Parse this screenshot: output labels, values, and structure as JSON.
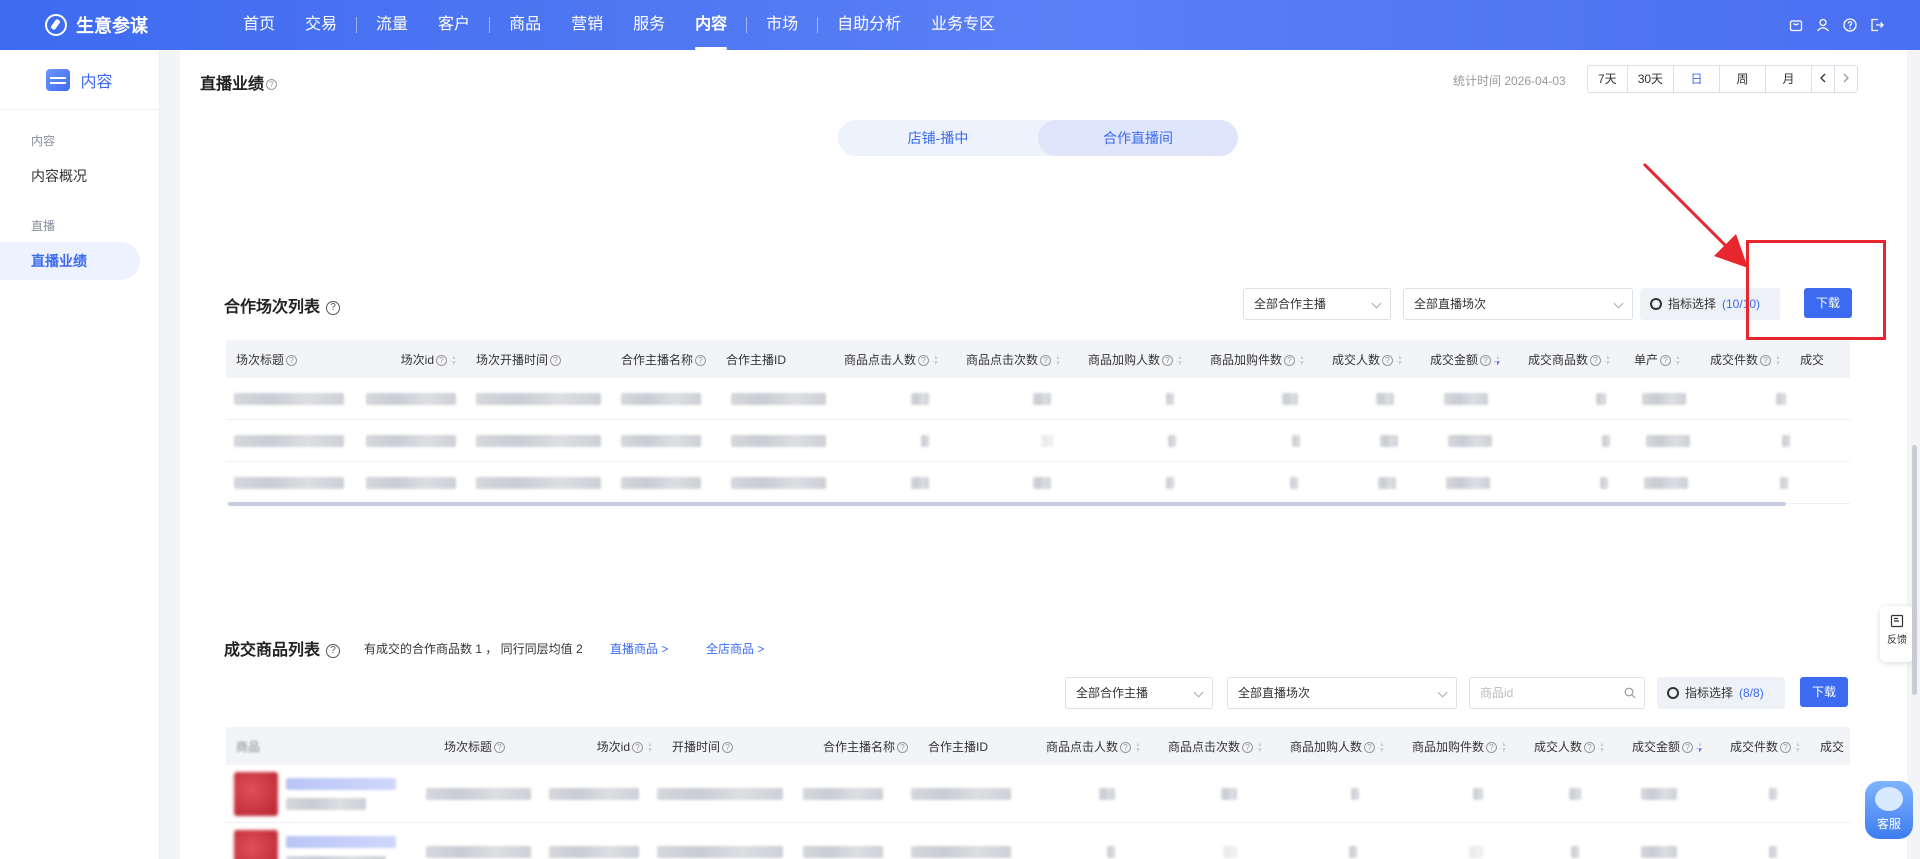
{
  "app": {
    "name": "生意参谋"
  },
  "nav": {
    "items": [
      "首页",
      "交易",
      "流量",
      "客户",
      "商品",
      "营销",
      "服务",
      "内容",
      "市场",
      "自助分析",
      "业务专区"
    ],
    "active": "内容"
  },
  "sidebar": {
    "header": "内容",
    "groups": [
      {
        "label": "内容",
        "items": [
          "内容概况"
        ]
      },
      {
        "label": "直播",
        "items": [
          "直播业绩"
        ]
      }
    ],
    "active_item": "直播业绩"
  },
  "page": {
    "title": "直播业绩",
    "stat_time": "统计时间 2026-04-03",
    "date_buttons": [
      "7天",
      "30天",
      "日",
      "周",
      "月"
    ],
    "date_active": "日",
    "segment": [
      "店铺-播中",
      "合作直播间"
    ],
    "segment_active": "合作直播间"
  },
  "session_list": {
    "title": "合作场次列表",
    "filter_anchor": "全部合作主播",
    "filter_session": "全部直播场次",
    "metric_label": "指标选择",
    "metric_count": "(10/10)",
    "download": "下载",
    "columns": [
      "场次标题",
      "场次id",
      "场次开播时间",
      "合作主播名称",
      "合作主播ID",
      "商品点击人数",
      "商品点击次数",
      "商品加购人数",
      "商品加购件数",
      "成交人数",
      "成交金额",
      "成交商品数",
      "单产",
      "成交件数",
      "成交"
    ],
    "row_count": 3
  },
  "deal_list": {
    "title": "成交商品列表",
    "info": "有成交的合作商品数 1 ， 同行同层均值 2",
    "link_live": "直播商品 >",
    "link_store": "全店商品 >",
    "filter_anchor": "全部合作主播",
    "filter_session": "全部直播场次",
    "search_placeholder": "商品id",
    "metric_label": "指标选择",
    "metric_count": "(8/8)",
    "download": "下载",
    "columns": [
      "商品",
      "场次标题",
      "场次id",
      "开播时间",
      "合作主播名称",
      "合作主播ID",
      "商品点击人数",
      "商品点击次数",
      "商品加购人数",
      "商品加购件数",
      "成交人数",
      "成交金额",
      "成交件数",
      "成交"
    ]
  },
  "floating": {
    "feedback": "反馈",
    "service": "客服"
  },
  "colors": {
    "brand": "#3d6bf0",
    "annotation": "#e8262e"
  }
}
